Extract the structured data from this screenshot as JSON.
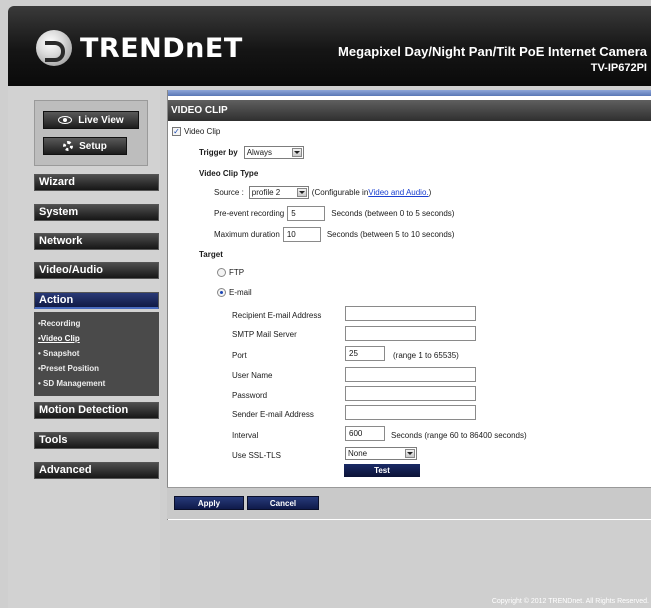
{
  "brand": {
    "logo_text": "TRENDnET"
  },
  "product": {
    "title": "Megapixel Day/Night Pan/Tilt PoE Internet Camera",
    "model": "TV-IP672PI"
  },
  "mode": {
    "live_view": "Live View",
    "setup": "Setup"
  },
  "nav": {
    "wizard": "Wizard",
    "system": "System",
    "network": "Network",
    "video_audio": "Video/Audio",
    "action": "Action",
    "motion_detection": "Motion Detection",
    "tools": "Tools",
    "advanced": "Advanced"
  },
  "submenu": [
    "•Recording",
    "•Video Clip",
    "• Snapshot",
    "•Preset Position",
    "• SD Management"
  ],
  "section": {
    "title": "VIDEO CLIP"
  },
  "form": {
    "video_clip_label": "Video Clip",
    "video_clip_checked": true,
    "trigger_label": "Trigger by",
    "trigger_value": "Always",
    "clip_type_label": "Video Clip Type",
    "source_label": "Source :",
    "source_value": "profile 2",
    "source_note_prefix": "(Configurable in ",
    "source_link": "Video and Audio.",
    "source_note_suffix": ")",
    "pre_event_label": "Pre-event recording",
    "pre_event_value": "5",
    "pre_event_note": "Seconds  (between 0 to 5 seconds)",
    "max_duration_label": "Maximum duration",
    "max_duration_value": "10",
    "max_duration_note": "Seconds  (between 5 to 10 seconds)",
    "target_label": "Target",
    "ftp_label": "FTP",
    "email_label": "E-mail",
    "recipient_label": "Recipient E-mail Address",
    "recipient_value": "",
    "smtp_label": "SMTP Mail Server",
    "smtp_value": "",
    "port_label": "Port",
    "port_value": "25",
    "port_note": "(range 1 to 65535)",
    "user_label": "User Name",
    "user_value": "",
    "password_label": "Password",
    "password_value": "",
    "sender_label": "Sender E-mail Address",
    "sender_value": "",
    "interval_label": "Interval",
    "interval_value": "600",
    "interval_note": "Seconds  (range 60 to 86400 seconds)",
    "ssl_label": "Use SSL-TLS",
    "ssl_value": "None",
    "test_label": "Test"
  },
  "actions": {
    "apply": "Apply",
    "cancel": "Cancel"
  },
  "footer": "Copyright © 2012 TRENDnet. All Rights Reserved."
}
